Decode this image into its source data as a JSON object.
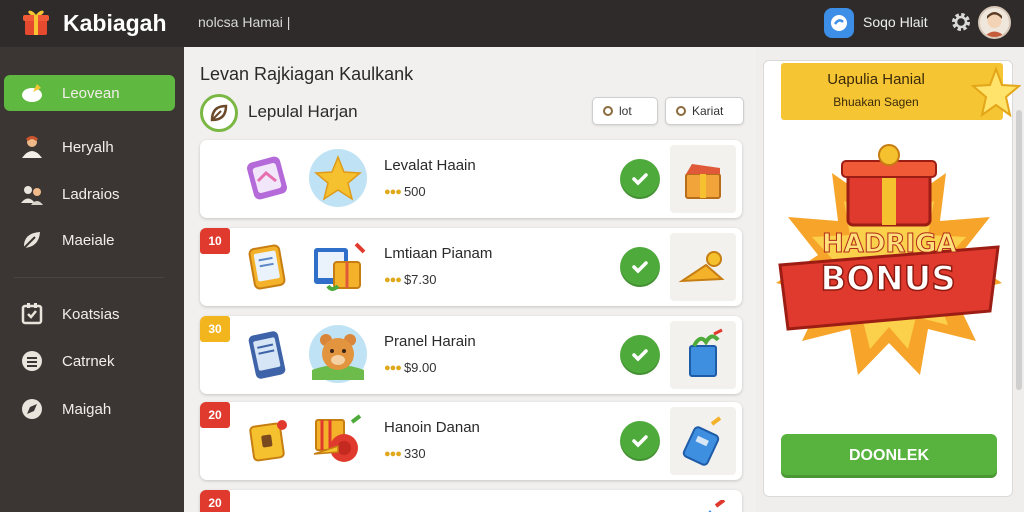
{
  "header": {
    "app_title": "Kabiagah",
    "search_text": "nolcsa Hamai |",
    "user_name": "Soqo Hlait"
  },
  "sidebar": {
    "items": [
      {
        "label": "Leovean",
        "icon": "trophy-icon",
        "active": true
      },
      {
        "label": "Heryalh",
        "icon": "user-icon",
        "active": false
      },
      {
        "label": "Ladraios",
        "icon": "friends-icon",
        "active": false
      },
      {
        "label": "Maeiale",
        "icon": "leaf-icon",
        "active": false
      },
      {
        "label": "Koatsias",
        "icon": "calendar-icon",
        "active": false
      },
      {
        "label": "Catrnek",
        "icon": "list-icon",
        "active": false
      },
      {
        "label": "Maigah",
        "icon": "compass-icon",
        "active": false
      }
    ]
  },
  "main": {
    "title": "Levan Rajkiagan Kaulkank",
    "subtitle": "Lepulal Harjan",
    "filters": [
      "lot",
      "Kariat"
    ],
    "rows": [
      {
        "rank": "",
        "name": "Levalat Haain",
        "score": "500",
        "rank_color": ""
      },
      {
        "rank": "10",
        "name": "Lmtiaan Pianam",
        "score": "$7.30",
        "rank_color": "#e03a2e"
      },
      {
        "rank": "30",
        "name": "Pranel Harain",
        "score": "$9.00",
        "rank_color": "#f2b51e"
      },
      {
        "rank": "20",
        "name": "Hanoin Danan",
        "score": "330",
        "rank_color": "#e03a2e"
      },
      {
        "rank": "20",
        "name": "",
        "score": "",
        "rank_color": "#e03a2e"
      }
    ]
  },
  "promo": {
    "line1": "Uapulia Hanial",
    "line2": "Bhuakan Sagen",
    "bonus_top": "HADRIGA",
    "bonus_main": "BONUS",
    "cta_label": "DOONLEK"
  },
  "colors": {
    "accent_green": "#5fb840",
    "topbar": "#2e2b2a",
    "sidebar": "#3b3633",
    "promo_yellow": "#f6c534"
  }
}
